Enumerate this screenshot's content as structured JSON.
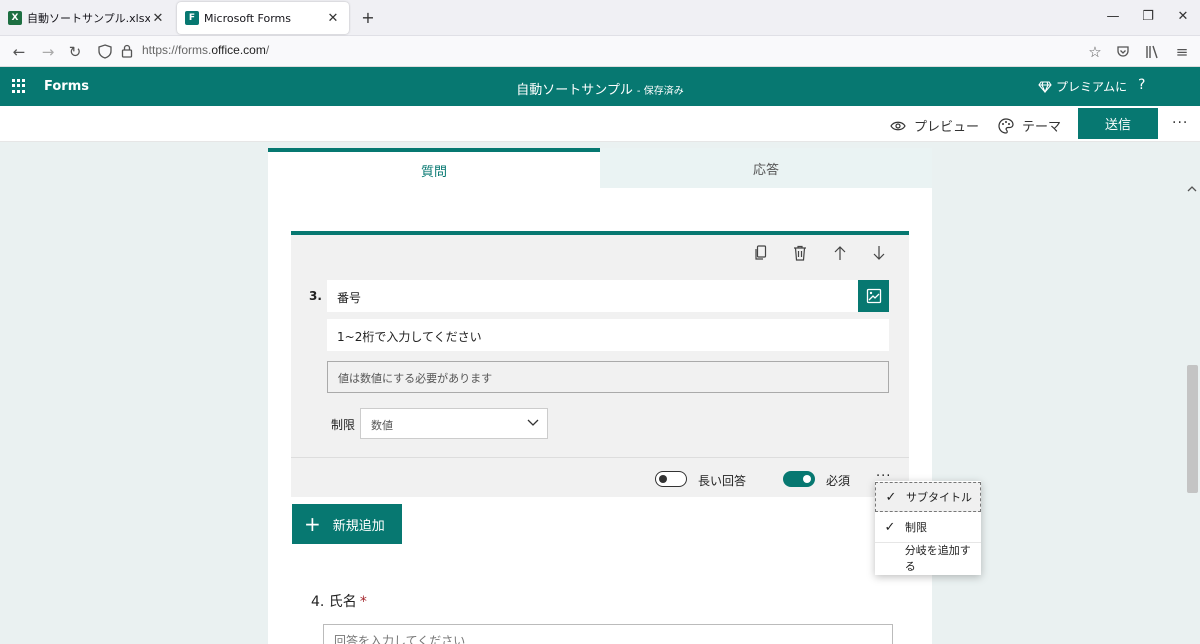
{
  "browser": {
    "tabs": [
      {
        "title": "自動ソートサンプル.xlsx - Microsoft",
        "icon": "excel-icon",
        "color": "#1d6f42"
      },
      {
        "title": "Microsoft Forms",
        "icon": "forms-icon",
        "color": "#077871"
      }
    ],
    "url_prefix": "https://forms.",
    "url_host": "office.com",
    "url_suffix": "/"
  },
  "app": {
    "name": "Forms",
    "form_title": "自動ソートサンプル",
    "saved_status": "- 保存済み",
    "premium": "プレミアムに",
    "help": "?",
    "accent": "#077871"
  },
  "commands": {
    "preview": "プレビュー",
    "theme": "テーマ",
    "send": "送信",
    "more": "···"
  },
  "form_tabs": {
    "questions": "質問",
    "responses": "応答"
  },
  "question3": {
    "number": "3.",
    "title": "番号",
    "subtitle": "1~2桁で入力してください",
    "answer_hint": "値は数値にする必要があります",
    "restriction_label": "制限",
    "restriction_value": "数値",
    "long_answer_label": "長い回答",
    "long_answer_on": false,
    "required_label": "必須",
    "required_on": true,
    "more": "···"
  },
  "add_new": "新規追加",
  "context_menu": [
    {
      "label": "サブタイトル",
      "checked": true
    },
    {
      "label": "制限",
      "checked": true
    },
    {
      "label": "分岐を追加する",
      "checked": false
    }
  ],
  "question4": {
    "title": "4. 氏名",
    "required_mark": "*",
    "placeholder": "回答を入力してください"
  }
}
